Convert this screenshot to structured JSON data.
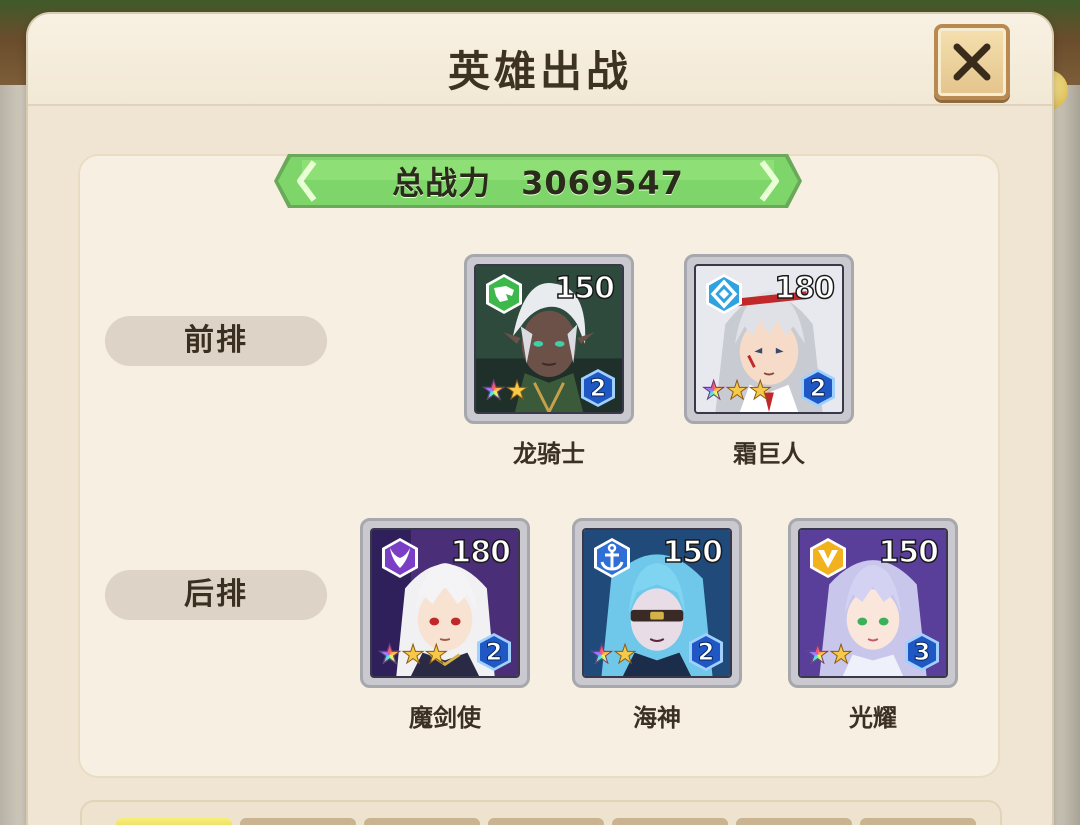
{
  "window": {
    "title": "英雄出战"
  },
  "power": {
    "label": "总战力",
    "value": "3069547"
  },
  "rows": {
    "front": {
      "label": "前排"
    },
    "back": {
      "label": "后排"
    }
  },
  "heroes": {
    "front": [
      {
        "name": "龙骑士",
        "level": "150",
        "rank": "2",
        "class_icon": "dragon-icon",
        "class_color": "#3db84a",
        "stars": 2
      },
      {
        "name": "霜巨人",
        "level": "180",
        "rank": "2",
        "class_icon": "diamond-shield-icon",
        "class_color": "#2fa2e0",
        "stars": 3
      }
    ],
    "back": [
      {
        "name": "魔剑使",
        "level": "180",
        "rank": "2",
        "class_icon": "horned-demon-icon",
        "class_color": "#7a3fc4",
        "stars": 3
      },
      {
        "name": "海神",
        "level": "150",
        "rank": "2",
        "class_icon": "anchor-icon",
        "class_color": "#2f6fd6",
        "stars": 2
      },
      {
        "name": "光耀",
        "level": "150",
        "rank": "3",
        "class_icon": "chevron-v-icon",
        "class_color": "#f2b21e",
        "stars": 2
      }
    ]
  },
  "colors": {
    "panel": "#efe5d2",
    "banner_green": "#66cc4a",
    "close_button": "#e3c48b"
  }
}
